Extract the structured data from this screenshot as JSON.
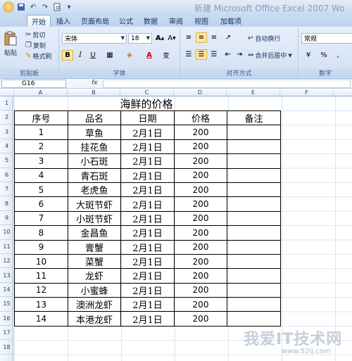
{
  "window": {
    "title": "新建 Microsoft Office Excel 2007 Wo"
  },
  "tabs": [
    {
      "label": "开始"
    },
    {
      "label": "插入"
    },
    {
      "label": "页面布局"
    },
    {
      "label": "公式"
    },
    {
      "label": "数据"
    },
    {
      "label": "审阅"
    },
    {
      "label": "视图"
    },
    {
      "label": "加载项"
    }
  ],
  "ribbon": {
    "clipboard": {
      "paste": "粘贴",
      "cut": "剪切",
      "copy": "复制",
      "painter": "格式刷",
      "group": "剪贴板"
    },
    "font": {
      "name": "宋体",
      "size": "18",
      "group": "字体",
      "bold": "B",
      "italic": "I",
      "underline": "U"
    },
    "alignment": {
      "wrap": "自动换行",
      "merge": "合并后居中",
      "group": "对齐方式"
    },
    "number": {
      "format": "常规",
      "group": "数字",
      "percent": "%",
      "comma": ","
    }
  },
  "formula_bar": {
    "name_box": "G16",
    "fx": "fx"
  },
  "columns": [
    "A",
    "B",
    "C",
    "D",
    "E",
    "F"
  ],
  "rows": [
    "1",
    "2",
    "3",
    "4",
    "5",
    "6",
    "7",
    "8",
    "9",
    "10",
    "11",
    "12",
    "13",
    "14",
    "15",
    "16",
    "17",
    "18"
  ],
  "sheet": {
    "title": "海鲜的价格",
    "headers": [
      "序号",
      "品名",
      "日期",
      "价格",
      "备注"
    ],
    "data": [
      [
        "1",
        "草鱼",
        "2月1日",
        "200",
        ""
      ],
      [
        "2",
        "挂花鱼",
        "2月1日",
        "200",
        ""
      ],
      [
        "3",
        "小石斑",
        "2月1日",
        "200",
        ""
      ],
      [
        "4",
        "青石斑",
        "2月1日",
        "200",
        ""
      ],
      [
        "5",
        "老虎鱼",
        "2月1日",
        "200",
        ""
      ],
      [
        "6",
        "大斑节虾",
        "2月1日",
        "200",
        ""
      ],
      [
        "7",
        "小斑节虾",
        "2月1日",
        "200",
        ""
      ],
      [
        "8",
        "金昌鱼",
        "2月1日",
        "200",
        ""
      ],
      [
        "9",
        "膏蟹",
        "2月1日",
        "200",
        ""
      ],
      [
        "10",
        "菜蟹",
        "2月1日",
        "200",
        ""
      ],
      [
        "11",
        "龙虾",
        "2月1日",
        "200",
        ""
      ],
      [
        "12",
        "小蜜蜂",
        "2月1日",
        "200",
        ""
      ],
      [
        "13",
        "澳洲龙虾",
        "2月1日",
        "200",
        ""
      ],
      [
        "14",
        "本港龙虾",
        "2月1日",
        "200",
        ""
      ]
    ]
  },
  "watermark": {
    "text": "我爱IT技术网",
    "url": "www.52ij.com"
  }
}
